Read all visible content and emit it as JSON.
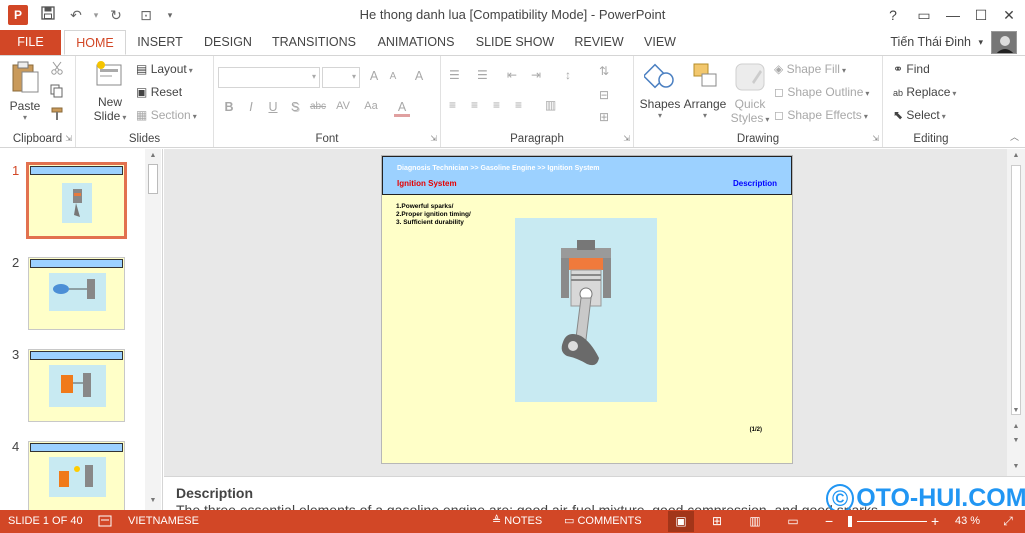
{
  "window": {
    "title": "He thong danh lua [Compatibility Mode] - PowerPoint",
    "app_logo": "P",
    "help": "?",
    "ribbon_display": "▭",
    "minimize": "—",
    "maximize": "☐",
    "close": "✕"
  },
  "qat": {
    "save_icon": "save-icon",
    "undo": "↶",
    "redo": "↻",
    "start_from_beginning": "⊡",
    "customize": "▾"
  },
  "tabs": {
    "file": "FILE",
    "items": [
      "HOME",
      "INSERT",
      "DESIGN",
      "TRANSITIONS",
      "ANIMATIONS",
      "SLIDE SHOW",
      "REVIEW",
      "VIEW"
    ],
    "active": "HOME"
  },
  "user": {
    "name": "Tiến Thái Đinh",
    "arrow": "▾"
  },
  "ribbon": {
    "clipboard": {
      "label": "Clipboard",
      "paste": "Paste",
      "paste_arrow": "▾"
    },
    "slides": {
      "label": "Slides",
      "new_slide_1": "New",
      "new_slide_2": "Slide",
      "new_slide_arrow": "▾",
      "layout": "Layout",
      "reset": "Reset",
      "section": "Section"
    },
    "font": {
      "label": "Font",
      "bold": "B",
      "italic": "I",
      "underline": "U",
      "shadow": "S",
      "strike": "abc",
      "spacing": "AV",
      "case": "Aa",
      "grow": "A",
      "shrink": "A",
      "clear": "A",
      "color": "A"
    },
    "paragraph": {
      "label": "Paragraph"
    },
    "drawing": {
      "label": "Drawing",
      "shapes": "Shapes",
      "arrange": "Arrange",
      "quick_styles_1": "Quick",
      "quick_styles_2": "Styles",
      "shape_fill": "Shape Fill",
      "shape_outline": "Shape Outline",
      "shape_effects": "Shape Effects"
    },
    "editing": {
      "label": "Editing",
      "find": "Find",
      "replace": "Replace",
      "select": "Select"
    }
  },
  "thumbnails": [
    {
      "number": "1",
      "active": true
    },
    {
      "number": "2",
      "active": false
    },
    {
      "number": "3",
      "active": false
    },
    {
      "number": "4",
      "active": false
    }
  ],
  "slide": {
    "breadcrumb": "Diagnosis Technician >> Gasoline Engine >> Ignition System",
    "section_title": "Ignition System",
    "desc_label": "Description",
    "points": [
      "1.Powerful sparks/",
      "2.Proper ignition timing/",
      "3. Sufficient durability"
    ],
    "page_label": "(1/2)"
  },
  "notes": {
    "title": "Description",
    "body": "The three essential elements of a gasoline engine are: good air-fuel mixture, good compression, and good sparks."
  },
  "status": {
    "slide_indicator": "SLIDE 1 OF 40",
    "language": "VIETNAMESE",
    "notes": "NOTES",
    "comments": "COMMENTS",
    "zoom_minus": "−",
    "zoom_plus": "+",
    "zoom": "43 %"
  },
  "watermark": "OTO-HUI.COM",
  "colors": {
    "accent": "#d24726",
    "slide_bg": "#ffffc8",
    "slide_header": "#9cd1ff",
    "image_bg": "#c8eaf2"
  }
}
